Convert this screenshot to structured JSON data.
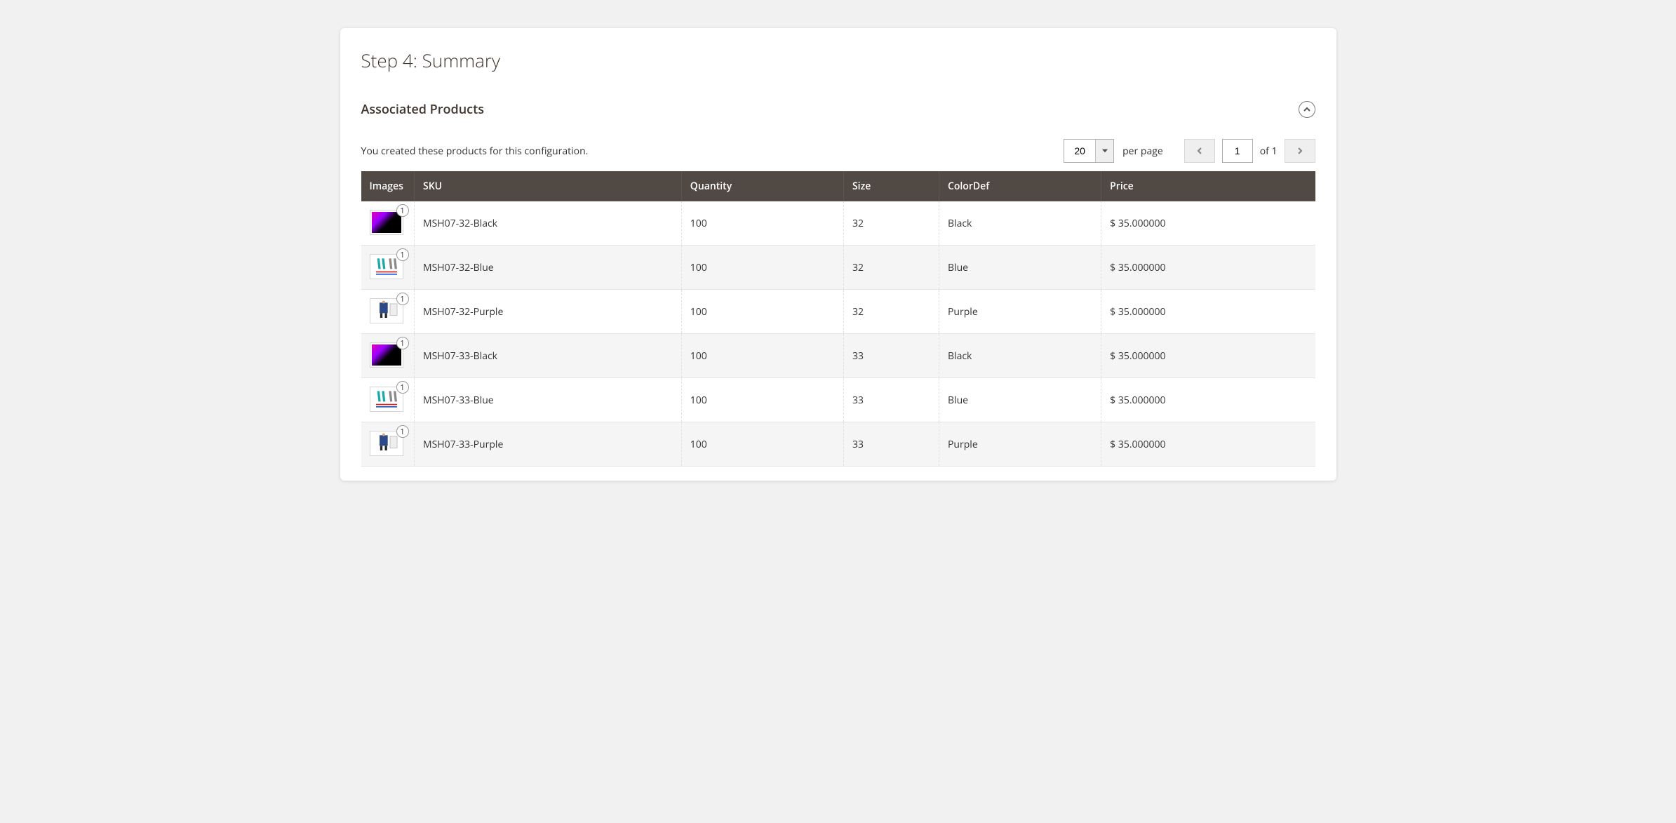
{
  "step_title": "Step 4: Summary",
  "section_title": "Associated Products",
  "description": "You created these products for this configuration.",
  "pagination": {
    "per_page": "20",
    "per_page_label": "per page",
    "current_page": "1",
    "total_pages_prefix": "of ",
    "total_pages": "1"
  },
  "columns": {
    "images": "Images",
    "sku": "SKU",
    "quantity": "Quantity",
    "size": "Size",
    "colordef": "ColorDef",
    "price": "Price"
  },
  "rows": [
    {
      "badge": "1",
      "swatch": "black",
      "sku": "MSH07-32-Black",
      "qty": "100",
      "size": "32",
      "color": "Black",
      "price": "$ 35.000000"
    },
    {
      "badge": "1",
      "swatch": "blue",
      "sku": "MSH07-32-Blue",
      "qty": "100",
      "size": "32",
      "color": "Blue",
      "price": "$ 35.000000"
    },
    {
      "badge": "1",
      "swatch": "purple",
      "sku": "MSH07-32-Purple",
      "qty": "100",
      "size": "32",
      "color": "Purple",
      "price": "$ 35.000000"
    },
    {
      "badge": "1",
      "swatch": "black",
      "sku": "MSH07-33-Black",
      "qty": "100",
      "size": "33",
      "color": "Black",
      "price": "$ 35.000000"
    },
    {
      "badge": "1",
      "swatch": "blue",
      "sku": "MSH07-33-Blue",
      "qty": "100",
      "size": "33",
      "color": "Blue",
      "price": "$ 35.000000"
    },
    {
      "badge": "1",
      "swatch": "purple",
      "sku": "MSH07-33-Purple",
      "qty": "100",
      "size": "33",
      "color": "Purple",
      "price": "$ 35.000000"
    }
  ]
}
